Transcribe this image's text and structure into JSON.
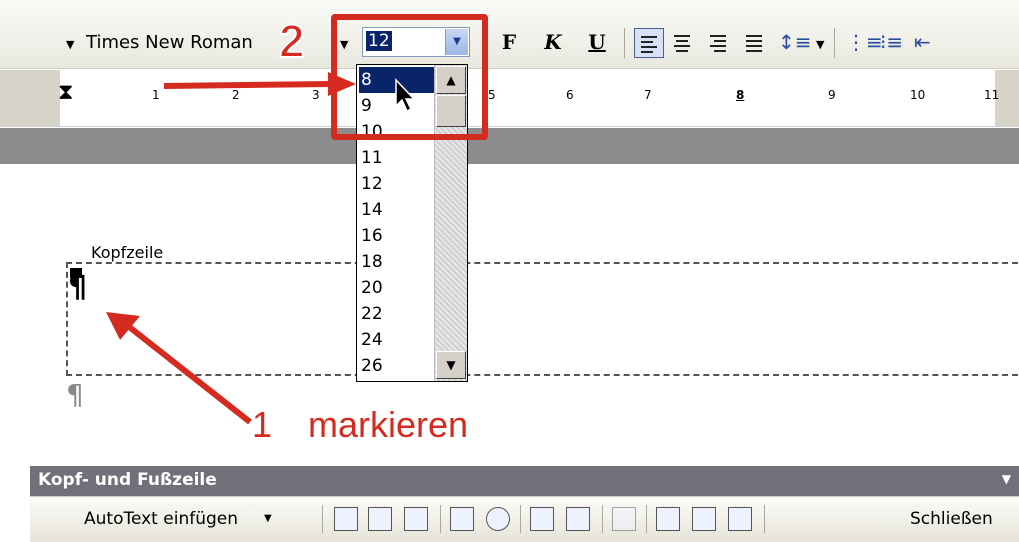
{
  "toolbar": {
    "font_name": "Times New Roman",
    "font_size": "12",
    "bold_label": "F",
    "italic_label": "K",
    "underline_label": "U"
  },
  "ruler": {
    "numbers": [
      "1",
      "2",
      "3",
      "5",
      "6",
      "7",
      "8",
      "9",
      "10",
      "11"
    ]
  },
  "font_size_list": {
    "items": [
      "8",
      "9",
      "10",
      "11",
      "12",
      "14",
      "16",
      "18",
      "20",
      "22",
      "24",
      "26"
    ],
    "selected": "8"
  },
  "document": {
    "header_label": "Kopfzeile",
    "paragraph_mark": "¶"
  },
  "annotations": {
    "step1_number": "1",
    "step1_text": "markieren",
    "step2_number": "2",
    "accent_color": "#d42a20"
  },
  "header_footer_toolbar": {
    "title": "Kopf- und Fußzeile",
    "autotext_label": "AutoText einfügen",
    "close_label": "Schließen"
  }
}
